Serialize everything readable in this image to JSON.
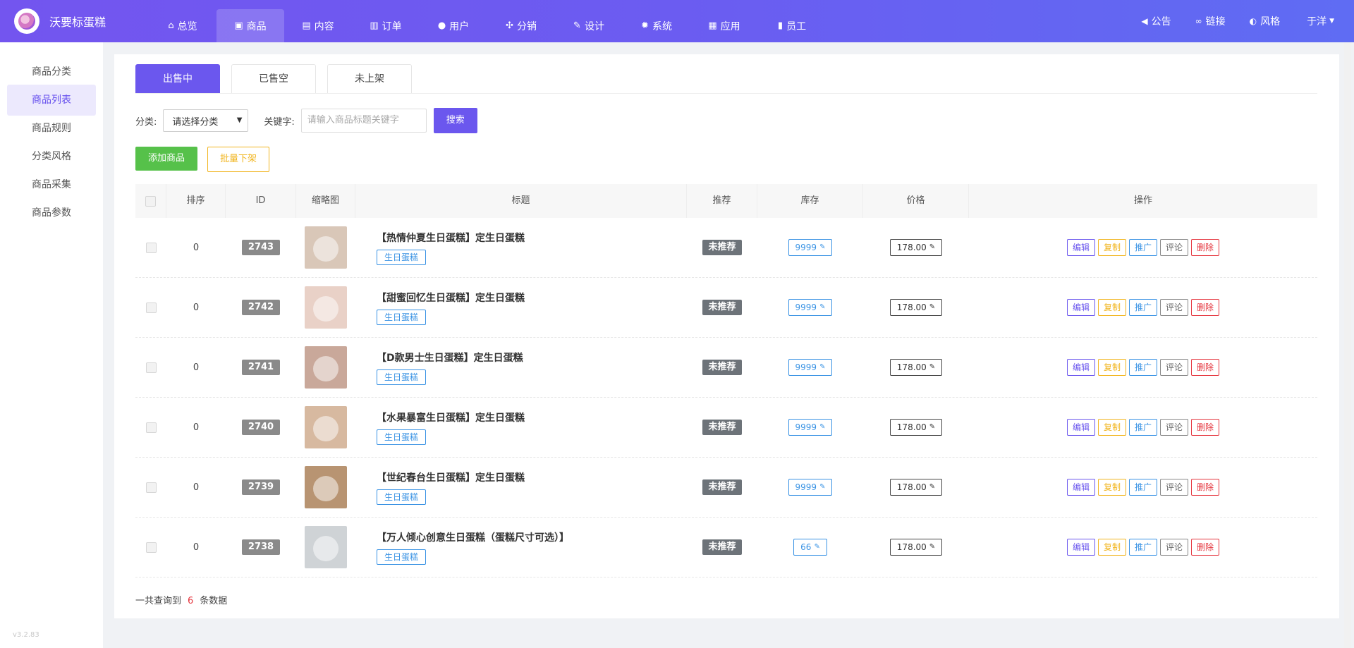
{
  "app": {
    "name": "沃要标蛋糕"
  },
  "nav": {
    "items": [
      {
        "label": "总览",
        "icon": "home-icon",
        "glyph": "⌂"
      },
      {
        "label": "商品",
        "icon": "shopping-bag-icon",
        "glyph": "▣"
      },
      {
        "label": "内容",
        "icon": "document-icon",
        "glyph": "▤"
      },
      {
        "label": "订单",
        "icon": "clipboard-icon",
        "glyph": "▥"
      },
      {
        "label": "用户",
        "icon": "user-icon",
        "glyph": "●"
      },
      {
        "label": "分销",
        "icon": "share-nodes-icon",
        "glyph": "✣"
      },
      {
        "label": "设计",
        "icon": "paint-brush-icon",
        "glyph": "✎"
      },
      {
        "label": "系统",
        "icon": "gear-icon",
        "glyph": "✹"
      },
      {
        "label": "应用",
        "icon": "grid-icon",
        "glyph": "▦"
      },
      {
        "label": "员工",
        "icon": "lock-icon",
        "glyph": "▮"
      }
    ],
    "active_index": 1,
    "right": [
      {
        "label": "公告",
        "icon": "megaphone-icon",
        "glyph": "◀"
      },
      {
        "label": "链接",
        "icon": "link-icon",
        "glyph": "∞"
      },
      {
        "label": "风格",
        "icon": "palette-icon",
        "glyph": "◐"
      }
    ],
    "user": "于洋",
    "user_caret": "▼"
  },
  "sidebar": {
    "items": [
      {
        "label": "商品分类"
      },
      {
        "label": "商品列表"
      },
      {
        "label": "商品规则"
      },
      {
        "label": "分类风格"
      },
      {
        "label": "商品采集"
      },
      {
        "label": "商品参数"
      }
    ],
    "active_index": 1,
    "version": "v3.2.83"
  },
  "tabs": {
    "items": [
      {
        "label": "出售中"
      },
      {
        "label": "已售空"
      },
      {
        "label": "未上架"
      }
    ],
    "active_index": 0
  },
  "filter": {
    "category_label": "分类:",
    "category_value": "请选择分类",
    "keyword_label": "关键字:",
    "keyword_placeholder": "请输入商品标题关键字",
    "search_button": "搜索"
  },
  "actions": {
    "add_button": "添加商品",
    "batch_button": "批量下架"
  },
  "table": {
    "headers": [
      "排序",
      "ID",
      "缩略图",
      "标题",
      "推荐",
      "库存",
      "价格",
      "操作"
    ],
    "rows": [
      {
        "sort": "0",
        "id": "2743",
        "title": "【热情仲夏生日蛋糕】定生日蛋糕",
        "tag": "生日蛋糕",
        "recommend": "未推荐",
        "stock": "9999",
        "price": "178.00",
        "thumb_color": "#d9c7b8"
      },
      {
        "sort": "0",
        "id": "2742",
        "title": "【甜蜜回忆生日蛋糕】定生日蛋糕",
        "tag": "生日蛋糕",
        "recommend": "未推荐",
        "stock": "9999",
        "price": "178.00",
        "thumb_color": "#e9d1c7"
      },
      {
        "sort": "0",
        "id": "2741",
        "title": "【D款男士生日蛋糕】定生日蛋糕",
        "tag": "生日蛋糕",
        "recommend": "未推荐",
        "stock": "9999",
        "price": "178.00",
        "thumb_color": "#c9a89a"
      },
      {
        "sort": "0",
        "id": "2740",
        "title": "【水果暴富生日蛋糕】定生日蛋糕",
        "tag": "生日蛋糕",
        "recommend": "未推荐",
        "stock": "9999",
        "price": "178.00",
        "thumb_color": "#d7b9a0"
      },
      {
        "sort": "0",
        "id": "2739",
        "title": "【世纪春台生日蛋糕】定生日蛋糕",
        "tag": "生日蛋糕",
        "recommend": "未推荐",
        "stock": "9999",
        "price": "178.00",
        "thumb_color": "#b89472"
      },
      {
        "sort": "0",
        "id": "2738",
        "title": "【万人倾心创意生日蛋糕（蛋糕尺寸可选）】",
        "tag": "生日蛋糕",
        "recommend": "未推荐",
        "stock": "66",
        "price": "178.00",
        "thumb_color": "#cfd3d6"
      }
    ],
    "ops": [
      "编辑",
      "复制",
      "推广",
      "评论",
      "删除"
    ]
  },
  "summary": {
    "prefix": "一共查询到",
    "count": "6",
    "suffix": "条数据"
  },
  "colors": {
    "primary": "#6b57ee",
    "success": "#56c14a",
    "warning": "#f1b51f",
    "info": "#3a93e4",
    "danger": "#e5363f"
  }
}
